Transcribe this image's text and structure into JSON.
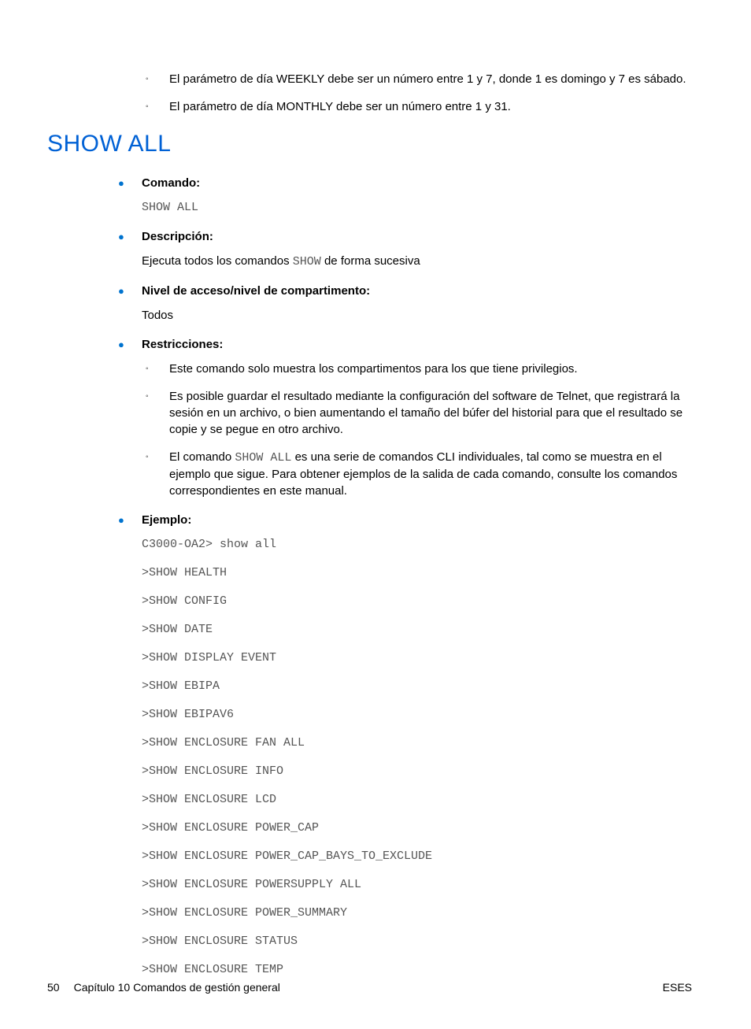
{
  "intro_sub": [
    "El parámetro de día WEEKLY debe ser un número entre 1 y 7, donde 1 es domingo y 7 es sábado.",
    "El parámetro de día MONTHLY debe ser un número entre 1 y 31."
  ],
  "section_title": "SHOW ALL",
  "labels": {
    "comando": "Comando:",
    "descripcion": "Descripción:",
    "nivel": "Nivel de acceso/nivel de compartimento:",
    "restricciones": "Restricciones:",
    "ejemplo": "Ejemplo:"
  },
  "comando_value": "SHOW ALL",
  "descripcion_pre": "Ejecuta todos los comandos ",
  "descripcion_code": "SHOW",
  "descripcion_post": " de forma sucesiva",
  "nivel_value": "Todos",
  "restricciones": {
    "r1": "Este comando solo muestra los compartimentos para los que tiene privilegios.",
    "r2": "Es posible guardar el resultado mediante la configuración del software de Telnet, que registrará la sesión en un archivo, o bien aumentando el tamaño del búfer del historial para que el resultado se copie y se pegue en otro archivo.",
    "r3_pre": "El comando ",
    "r3_code": "SHOW ALL",
    "r3_post": " es una serie de comandos CLI individuales, tal como se muestra en el ejemplo que sigue. Para obtener ejemplos de la salida de cada comando, consulte los comandos correspondientes en este manual."
  },
  "example_lines": [
    "C3000-OA2> show all",
    ">SHOW HEALTH",
    ">SHOW CONFIG",
    ">SHOW DATE",
    ">SHOW DISPLAY EVENT",
    ">SHOW EBIPA",
    ">SHOW EBIPAV6",
    ">SHOW ENCLOSURE FAN ALL",
    ">SHOW ENCLOSURE INFO",
    ">SHOW ENCLOSURE LCD",
    ">SHOW ENCLOSURE POWER_CAP",
    ">SHOW ENCLOSURE POWER_CAP_BAYS_TO_EXCLUDE",
    ">SHOW ENCLOSURE POWERSUPPLY ALL",
    ">SHOW ENCLOSURE POWER_SUMMARY",
    ">SHOW ENCLOSURE STATUS",
    ">SHOW ENCLOSURE TEMP"
  ],
  "footer": {
    "page": "50",
    "chapter": "Capítulo 10   Comandos de gestión general",
    "lang": "ESES"
  }
}
